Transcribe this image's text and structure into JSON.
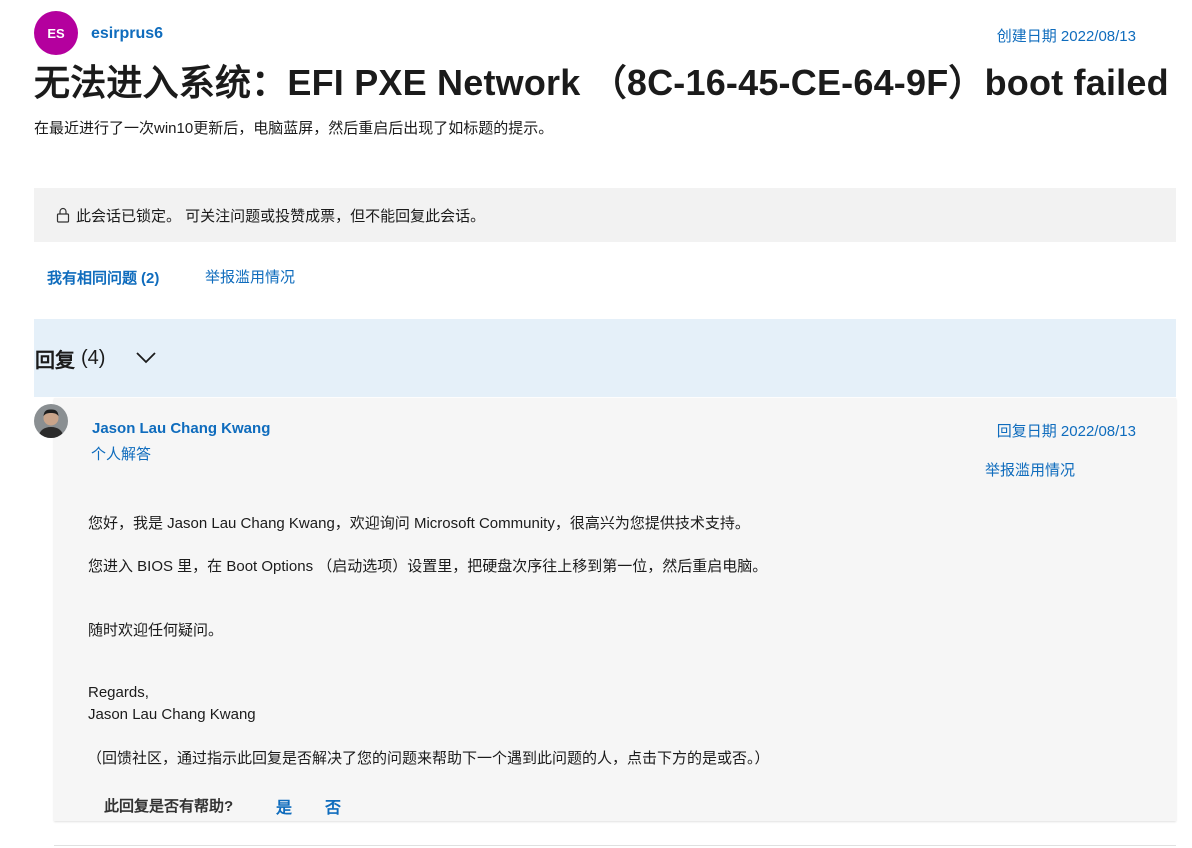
{
  "question": {
    "author_initials": "ES",
    "author_name": "esirprus6",
    "created_date": "创建日期 2022/08/13",
    "title": "无法进入系统：EFI PXE Network （8C-16-45-CE-64-9F）boot failed",
    "description": "在最近进行了一次win10更新后，电脑蓝屏，然后重启后出现了如标题的提示。",
    "avatar_color": "#b4009e"
  },
  "locked_banner": {
    "icon": "lock-icon",
    "text": "此会话已锁定。 可关注问题或投赞成票，但不能回复此会话。"
  },
  "actions": {
    "same_question_label": "我有相同问题",
    "same_question_count": "(2)",
    "report_label": "举报滥用情况"
  },
  "replies": {
    "title": "回复",
    "count": "(4)",
    "toggle_icon": "chevron-down-icon"
  },
  "reply": {
    "author_name": "Jason Lau Chang Kwang",
    "author_role": "个人解答",
    "reply_date": "回复日期 2022/08/13",
    "report_label": "举报滥用情况",
    "paragraphs": [
      "您好，我是 Jason Lau Chang Kwang，欢迎询问 Microsoft Community，很高兴为您提供技术支持。",
      "您进入 BIOS 里，在 Boot Options （启动选项）设置里，把硬盘次序往上移到第一位，然后重启电脑。",
      "随时欢迎任何疑问。",
      "Regards,",
      "Jason Lau Chang Kwang",
      "（回馈社区，通过指示此回复是否解决了您的问题来帮助下一个遇到此问题的人，点击下方的是或否。）"
    ],
    "helpful_question": "此回复是否有帮助?",
    "helpful_yes": "是",
    "helpful_no": "否"
  },
  "colors": {
    "accent": "#0f6cbd",
    "locked_bg": "#f2f2f2",
    "replies_header_bg": "#e5f0f9",
    "reply_card_bg": "#f6f6f6"
  }
}
